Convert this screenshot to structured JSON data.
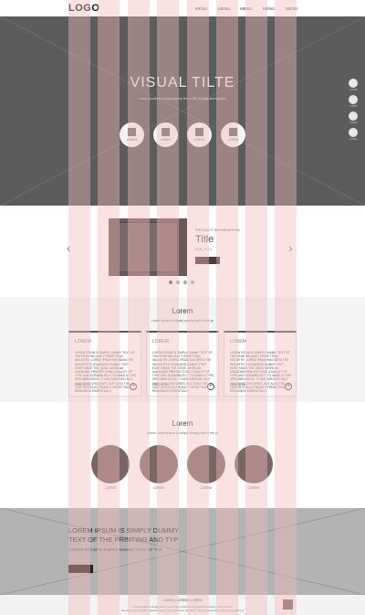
{
  "header": {
    "logo": "LOGO",
    "menu": [
      "MENU",
      "MENU",
      "MENU",
      "MENU",
      "MENU"
    ]
  },
  "hero": {
    "title": "VISUAL TILTE",
    "subtitle": "Lorem Ipsum is simply dummy text of the printing and typeset",
    "icons": [
      "LOREM",
      "LOREM",
      "LOREM",
      "LOREM"
    ],
    "side_dots": [
      "LOREM",
      "LOREM",
      "LOREM",
      "LOREM"
    ]
  },
  "product": {
    "label": "PRODUCT INFORMATION",
    "title": "Title",
    "subtitle": "SUB_TITLE",
    "prev_icon": "chevron-left-icon",
    "next_icon": "chevron-right-icon",
    "active_dot": 1,
    "dot_count": 4
  },
  "cards": {
    "title": "Lorem",
    "subtitle": "Lorem Ipsum is simply dummy text of the pr",
    "items": [
      {
        "title": "LOREM",
        "body": "LOREM IPSUM IS SIMPLY DUMMY TEXT OF THE PRINTING AND TYPESETTING INDUSTRY. LOREM IPSUM HAS BEEN THE INDUSTRY'S STANDARD DUMMY TEXT EVER SINCE THE 1500S, WHEN AN UNKNOWN PRINTER TOOK A GALLEY OF TYPE AND SCRAMBLED IT TO MAKE A TYPE SPECIMEN BOOK. IT HAS SURVIVED NOT ONLY FIVE CENTURIES, BUT ALSO THE LEAP INTO ELECTRONIC TYPESETTING, REMAINING ESSENTIALLY",
        "date": "2015-06-02"
      },
      {
        "title": "LOREM",
        "body": "LOREM IPSUM IS SIMPLY DUMMY TEXT OF THE PRINTING AND TYPESETTING INDUSTRY. LOREM IPSUM HAS BEEN THE INDUSTRY'S STANDARD DUMMY TEXT EVER SINCE THE 1500S, WHEN AN UNKNOWN PRINTER TOOK A GALLEY OF TYPE AND SCRAMBLED IT TO MAKE A TYPE SPECIMEN BOOK. IT HAS SURVIVED NOT ONLY FIVE CENTURIES, BUT ALSO THE LEAP INTO ELECTRONIC TYPESETTING, REMAINING ESSENTIALLY",
        "date": "2015-06-05"
      },
      {
        "title": "LOREM",
        "body": "LOREM IPSUM IS SIMPLY DUMMY TEXT OF THE PRINTING AND TYPESETTING INDUSTRY. LOREM IPSUM HAS BEEN THE INDUSTRY'S STANDARD DUMMY TEXT EVER SINCE THE 1500S, WHEN AN UNKNOWN PRINTER TOOK A GALLEY OF TYPE AND SCRAMBLED IT TO MAKE A TYPE SPECIMEN BOOK. IT HAS SURVIVED NOT ONLY FIVE CENTURIES, BUT ALSO THE LEAP INTO ELECTRONIC TYPESETTING, REMAINING ESSENTIALLY",
        "date": "2015-06-05"
      }
    ],
    "more_icon": "plus-circle-icon"
  },
  "circles": {
    "title": "Lorem",
    "subtitle": "Lorem Lorem Ipsum is simply dummy text of the pr",
    "items": [
      "LOREM",
      "LOREM",
      "LOREM",
      "LOREM"
    ]
  },
  "banner": {
    "title_line1": "LOREM IPSUM IS SIMPLY DUMMY",
    "title_line2": "TEXT OF THE PRINTING AND TYP",
    "subtitle": "LOREM IPSUM IS SIMPLY DUMMY TEXT OF THE"
  },
  "footer": {
    "links": "LOREM  |  LOREM  |  LOREM",
    "line1": "Lorem Ipsum is simply dummy text of the printing and typesetting industry. Lorem Ipsum",
    "line2": "has been the industry's standard dummy text ever since the 1500s, when an unknown printer took a galley of"
  },
  "colors": {
    "grid_overlay": "#f5b9b9",
    "hero_bg": "#5c5c5c",
    "accent": "#7b6666",
    "dark_button": "#2e1e1e"
  }
}
